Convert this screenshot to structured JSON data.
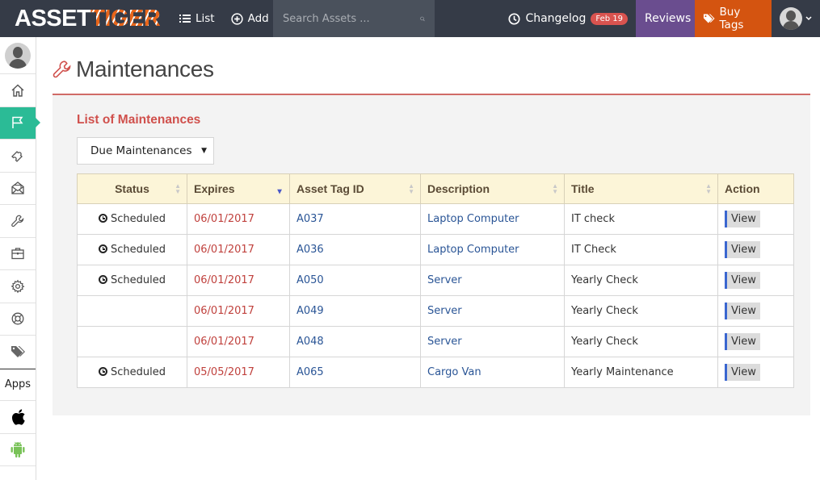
{
  "app": {
    "logo_part1": "ASSET",
    "logo_part2": "TIGER"
  },
  "topnav": {
    "list_label": "List",
    "add_label": "Add",
    "search_placeholder": "Search Assets ...",
    "changelog_label": "Changelog",
    "changelog_badge": "Feb 19",
    "reviews_label": "Reviews",
    "buy_tags_label": "Buy Tags"
  },
  "sidebar": {
    "items": [
      {
        "name": "profile",
        "icon": "avatar"
      },
      {
        "name": "home",
        "icon": "home-icon"
      },
      {
        "name": "maintenances",
        "icon": "flag-icon",
        "active": true
      },
      {
        "name": "check-out",
        "icon": "puzzle-icon"
      },
      {
        "name": "reservations",
        "icon": "mail-open-icon"
      },
      {
        "name": "maintenance",
        "icon": "wrench-icon"
      },
      {
        "name": "reports",
        "icon": "briefcase-icon"
      },
      {
        "name": "settings",
        "icon": "gear-icon"
      },
      {
        "name": "help",
        "icon": "lifebuoy-icon"
      },
      {
        "name": "tags",
        "icon": "tags-icon"
      }
    ],
    "apps_label": "Apps",
    "apps": [
      {
        "name": "ios",
        "icon": "apple-icon"
      },
      {
        "name": "android",
        "icon": "android-icon"
      }
    ]
  },
  "page": {
    "title": "Maintenances",
    "panel_heading": "List of Maintenances",
    "filter_selected": "Due Maintenances"
  },
  "table": {
    "headers": [
      "Status",
      "Expires",
      "Asset Tag ID",
      "Description",
      "Title",
      "Action"
    ],
    "sorted_column": "Expires",
    "sort_direction": "descending",
    "rows": [
      {
        "status": "Scheduled",
        "expires": "06/01/2017",
        "asset_tag": "A037",
        "description": "Laptop Computer",
        "title": "IT check",
        "action": "View"
      },
      {
        "status": "Scheduled",
        "expires": "06/01/2017",
        "asset_tag": "A036",
        "description": "Laptop Computer",
        "title": "IT Check",
        "action": "View"
      },
      {
        "status": "Scheduled",
        "expires": "06/01/2017",
        "asset_tag": "A050",
        "description": "Server",
        "title": "Yearly Check",
        "action": "View"
      },
      {
        "status": "",
        "expires": "06/01/2017",
        "asset_tag": "A049",
        "description": "Server",
        "title": "Yearly Check",
        "action": "View"
      },
      {
        "status": "",
        "expires": "06/01/2017",
        "asset_tag": "A048",
        "description": "Server",
        "title": "Yearly Check",
        "action": "View"
      },
      {
        "status": "Scheduled",
        "expires": "05/05/2017",
        "asset_tag": "A065",
        "description": "Cargo Van",
        "title": "Yearly Maintenance",
        "action": "View"
      }
    ]
  },
  "colors": {
    "nav_bg": "#353b47",
    "reviews_bg": "#6a4d8f",
    "buy_tags_bg": "#d45410",
    "sidebar_active": "#2bbb96",
    "heading_red": "#d0504c",
    "date_red": "#c0413d",
    "link_blue": "#2a5596",
    "header_bg": "#fcf5d8"
  }
}
